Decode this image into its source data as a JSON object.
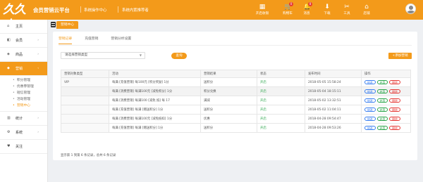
{
  "header": {
    "logo_text": "久久吉",
    "brand": "会员营销云平台",
    "crumbs": [
      "系统操作中心",
      "系统内置推荐者"
    ],
    "icons": [
      {
        "name": "cashier-icon",
        "glyph": "▦",
        "label": "开启收银",
        "badge": ""
      },
      {
        "name": "cart-icon",
        "glyph": "🛒",
        "label": "购物车",
        "badge": "0"
      },
      {
        "name": "message-icon",
        "glyph": "🔔",
        "label": "消息",
        "badge": "8"
      },
      {
        "name": "download-icon",
        "glyph": "⬇",
        "label": "下载",
        "badge": ""
      },
      {
        "name": "tools-icon",
        "glyph": "✂",
        "label": "工具",
        "badge": ""
      },
      {
        "name": "store-icon",
        "glyph": "⌂",
        "label": "店铺",
        "badge": ""
      }
    ]
  },
  "sidebar": {
    "items": [
      {
        "label": "主页",
        "icon": "⌂",
        "chevron": ""
      },
      {
        "label": "会员",
        "icon": "◧",
        "chevron": "›"
      },
      {
        "label": "商品",
        "icon": "◈",
        "chevron": "›"
      },
      {
        "label": "营销",
        "icon": "◆",
        "chevron": "‹"
      }
    ],
    "subitems": [
      "积分管理",
      "优惠券管理",
      "短信管理",
      "活动管理",
      "营销中心"
    ],
    "items_after": [
      {
        "label": "统计",
        "icon": "▥",
        "chevron": "›"
      },
      {
        "label": "系统",
        "icon": "⚙",
        "chevron": "›"
      },
      {
        "label": "关注",
        "icon": "♥",
        "chevron": ""
      }
    ]
  },
  "page_tab": "营销中心",
  "subtabs": [
    "营销记录",
    "充值营销",
    "营销分析设置"
  ],
  "filter": {
    "select_value": "请选择营销类型",
    "search_label": "查询",
    "add_label": "+添加营销"
  },
  "table": {
    "headers": [
      "营销对象类型",
      "活动",
      "营销结果",
      "状态",
      "发布时间",
      "操作"
    ],
    "rows": [
      {
        "target": "VIP",
        "activity": "每满 [充值营销] 每100元 [积分奖励] 1分",
        "result": "送积分",
        "status": "开启",
        "time": "2018-05-05 15:58:24",
        "hl": false
      },
      {
        "target": "",
        "activity": "每满 [消费营销] 每满100元 [减免积分] 1分",
        "result": "积分兑换",
        "status": "开启",
        "time": "2018-05-04 18:15:11",
        "hl": true
      },
      {
        "target": "",
        "activity": "每满 [消费营销] 每满100 [减免 抵] 每 17",
        "result": "满减",
        "status": "开启",
        "time": "2018-05-02 13:32:51",
        "hl": false
      },
      {
        "target": "",
        "activity": "每满 [充值营销] 每满 [赠送积分] 1分",
        "result": "送积分",
        "status": "开启",
        "time": "2018-05-02 11:04:11",
        "hl": false
      },
      {
        "target": "",
        "activity": "每满 [消费营销] 每满100元 [减免抵扣] 1分",
        "result": "优惠",
        "status": "开启",
        "time": "2018-04-28 09:54:47",
        "hl": false
      },
      {
        "target": "",
        "activity": "每满 [充值营销] 每满 [赠送积分] 1分",
        "result": "送积分",
        "status": "开启",
        "time": "2018-04-28 09:53:26",
        "hl": false
      }
    ],
    "ops": {
      "edit": "修改",
      "pay": "启用",
      "del": "删除"
    }
  },
  "footer": "显示第 1 到第 6 条记录，总共 6 条记录"
}
